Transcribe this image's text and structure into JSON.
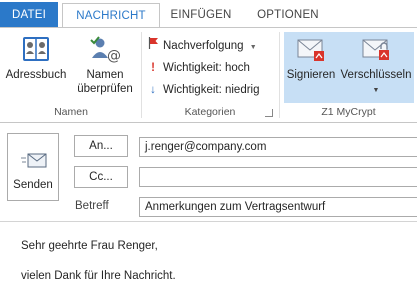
{
  "tabs": [
    {
      "label": "DATEI"
    },
    {
      "label": "NACHRICHT"
    },
    {
      "label": "EINFÜGEN"
    },
    {
      "label": "OPTIONEN"
    }
  ],
  "ribbon": {
    "names_group": {
      "label": "Namen",
      "address_book": "Adressbuch",
      "check_names_line1": "Namen",
      "check_names_line2": "überprüfen"
    },
    "categories_group": {
      "label": "Kategorien",
      "follow_up": "Nachverfolgung",
      "importance_high": "Wichtigkeit: hoch",
      "importance_low": "Wichtigkeit: niedrig"
    },
    "crypt_group": {
      "label": "Z1 MyCrypt",
      "sign": "Signieren",
      "encrypt": "Verschlüsseln"
    }
  },
  "compose": {
    "send_label": "Senden",
    "to_button": "An...",
    "cc_button": "Cc...",
    "to_value": "j.renger@company.com",
    "cc_value": "",
    "subject_label": "Betreff",
    "subject_value": "Anmerkungen zum Vertragsentwurf",
    "body_lines": [
      "Sehr geehrte Frau Renger,",
      "vielen Dank für Ihre Nachricht."
    ]
  },
  "colors": {
    "accent": "#2b79c9",
    "crypt_highlight": "#c7dff5",
    "flag_red": "#d9342b",
    "arrow_blue": "#2e6fc1"
  }
}
